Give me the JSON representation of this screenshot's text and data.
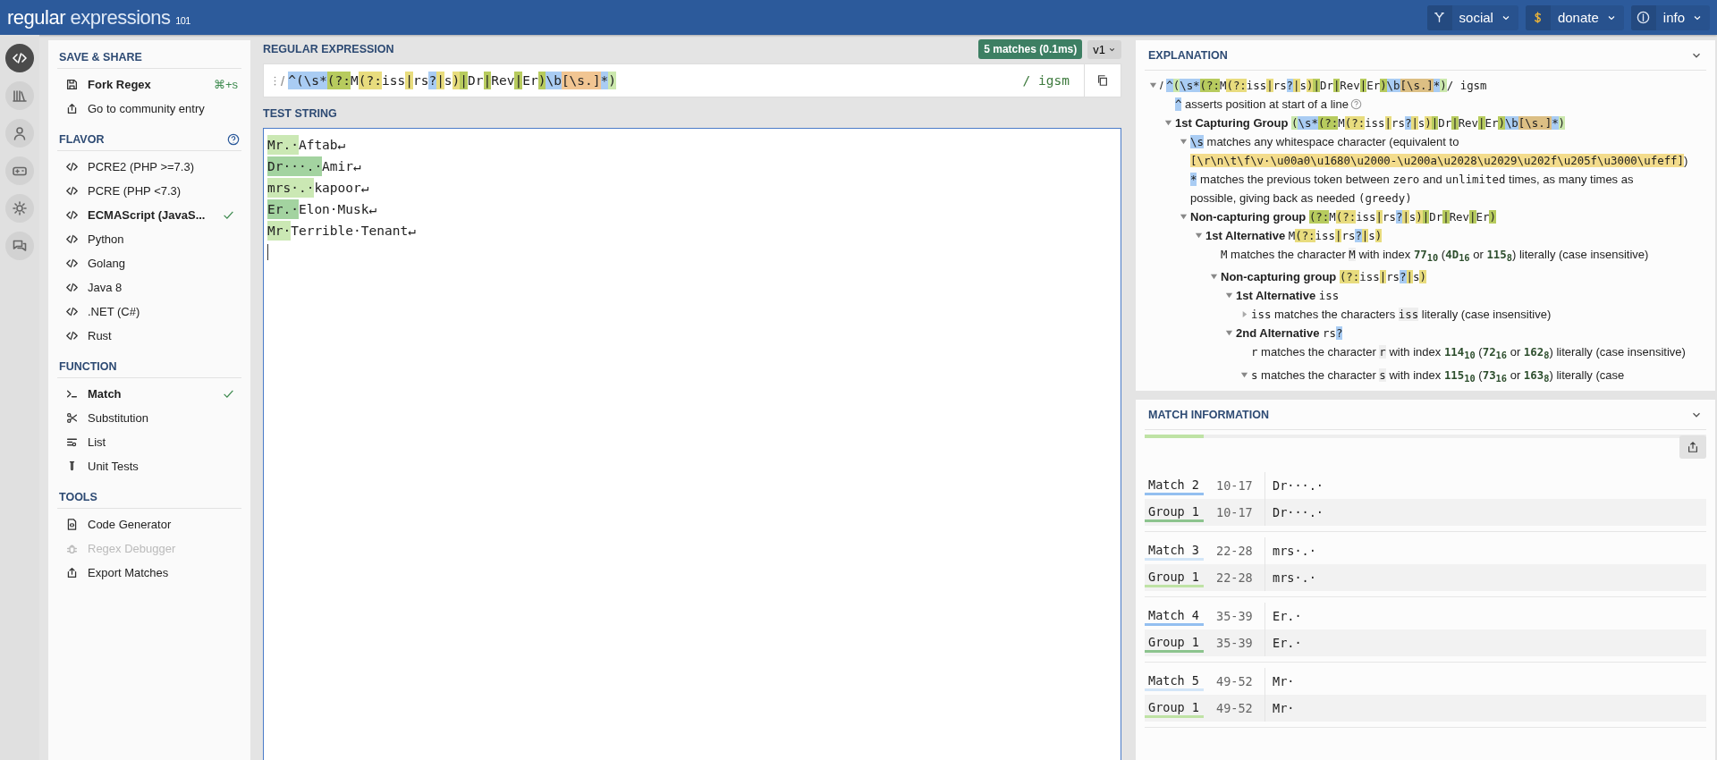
{
  "topbar": {
    "logo": {
      "word1": "regular",
      "word2": "expressions",
      "version": "101"
    },
    "menus": [
      {
        "label": "social"
      },
      {
        "label": "donate"
      },
      {
        "label": "info"
      }
    ]
  },
  "rail": [
    {
      "selected": true
    },
    {
      "selected": false
    },
    {
      "selected": false
    },
    {
      "selected": false
    },
    {
      "selected": false
    },
    {
      "selected": false
    }
  ],
  "sidebar": {
    "sections": [
      {
        "title": "SAVE & SHARE",
        "items": [
          {
            "label": "Fork Regex",
            "bold": true,
            "shortcut": "⌘+s"
          },
          {
            "label": "Go to community entry",
            "bold": false
          }
        ]
      },
      {
        "title": "FLAVOR",
        "help": true,
        "items": [
          {
            "label": "PCRE2 (PHP >=7.3)",
            "selected": false
          },
          {
            "label": "PCRE (PHP <7.3)",
            "selected": false
          },
          {
            "label": "ECMAScript (JavaS...",
            "selected": true
          },
          {
            "label": "Python",
            "selected": false
          },
          {
            "label": "Golang",
            "selected": false
          },
          {
            "label": "Java 8",
            "selected": false
          },
          {
            "label": ".NET (C#)",
            "selected": false
          },
          {
            "label": "Rust",
            "selected": false
          }
        ]
      },
      {
        "title": "FUNCTION",
        "items": [
          {
            "label": "Match",
            "selected": true
          },
          {
            "label": "Substitution",
            "selected": false
          },
          {
            "label": "List",
            "selected": false
          },
          {
            "label": "Unit Tests",
            "selected": false
          }
        ]
      },
      {
        "title": "TOOLS",
        "items": [
          {
            "label": "Code Generator",
            "disabled": false
          },
          {
            "label": "Regex Debugger",
            "disabled": true
          },
          {
            "label": "Export Matches",
            "disabled": false
          }
        ]
      }
    ]
  },
  "regex": {
    "title": "REGULAR EXPRESSION",
    "badge": "5 matches (0.1ms)",
    "version": "v1",
    "delimiter": "/",
    "flags": "/ igsm",
    "tokens": [
      {
        "t": "^",
        "color": "#a9ccf3"
      },
      {
        "t": "(",
        "color": "#a9ccf3"
      },
      {
        "t": "\\s*",
        "color": "#a9ccf3"
      },
      {
        "t": "(?:",
        "color": "#b7cb5e"
      },
      {
        "t": "M"
      },
      {
        "t": "(?:",
        "color": "#e8dc7e"
      },
      {
        "t": "iss"
      },
      {
        "t": "|",
        "color": "#e8dc7e"
      },
      {
        "t": "rs"
      },
      {
        "t": "?",
        "color": "#a9ccf3"
      },
      {
        "t": "|",
        "color": "#e8dc7e"
      },
      {
        "t": "s"
      },
      {
        "t": ")",
        "color": "#e8dc7e"
      },
      {
        "t": "|",
        "color": "#b7cb5e"
      },
      {
        "t": "Dr"
      },
      {
        "t": "|",
        "color": "#b7cb5e"
      },
      {
        "t": "Rev"
      },
      {
        "t": "|",
        "color": "#b7cb5e"
      },
      {
        "t": "Er"
      },
      {
        "t": ")",
        "color": "#b7cb5e"
      },
      {
        "t": "\\b",
        "color": "#a9ccf3"
      },
      {
        "t": "[\\s.]",
        "color": "#f1c592"
      },
      {
        "t": "*",
        "color": "#a9ccf3"
      },
      {
        "t": ")",
        "color": "#cbe8ad"
      }
    ]
  },
  "test_string": {
    "title": "TEST STRING",
    "lines": [
      {
        "match": "Mr.·",
        "rest": "Aftab↵",
        "color": "#cbe8b4"
      },
      {
        "match": "Dr···.·",
        "rest": "Amir↵",
        "color": "#a3d3a0"
      },
      {
        "match": "mrs·.·",
        "rest": "kapoor↵",
        "color": "#cbe8b4"
      },
      {
        "match": "Er.·",
        "rest": "Elon·Musk↵",
        "color": "#a3d3a0"
      },
      {
        "match": "Mr·",
        "rest": "Terrible·Tenant↵",
        "color": "#cbe8b4"
      }
    ]
  },
  "explanation": {
    "title": "EXPLANATION",
    "tree": [
      {
        "expanded": true,
        "parts": [
          {
            "kind": "text",
            "t": "/"
          },
          {
            "kind": "code",
            "t": "^",
            "color": "#a9ccf3"
          },
          {
            "kind": "code",
            "t": "(",
            "color": "#cbe8ad"
          },
          {
            "kind": "code",
            "t": "\\s*",
            "color": "#a9ccf3"
          },
          {
            "kind": "code",
            "t": "(?:",
            "color": "#b7cb5e"
          },
          {
            "kind": "code",
            "t": "M"
          },
          {
            "kind": "code",
            "t": "(?:",
            "color": "#e8dc7e"
          },
          {
            "kind": "code",
            "t": "iss"
          },
          {
            "kind": "code",
            "t": "|",
            "color": "#e8dc7e"
          },
          {
            "kind": "code",
            "t": "rs"
          },
          {
            "kind": "code",
            "t": "?",
            "color": "#a9ccf3"
          },
          {
            "kind": "code",
            "t": "|",
            "color": "#e8dc7e"
          },
          {
            "kind": "code",
            "t": "s"
          },
          {
            "kind": "code",
            "t": ")",
            "color": "#e8dc7e"
          },
          {
            "kind": "code",
            "t": "|",
            "color": "#b7cb5e"
          },
          {
            "kind": "code",
            "t": "Dr"
          },
          {
            "kind": "code",
            "t": "|",
            "color": "#b7cb5e"
          },
          {
            "kind": "code",
            "t": "Rev"
          },
          {
            "kind": "code",
            "t": "|",
            "color": "#b7cb5e"
          },
          {
            "kind": "code",
            "t": "Er"
          },
          {
            "kind": "code",
            "t": ")",
            "color": "#b7cb5e"
          },
          {
            "kind": "code",
            "t": "\\b",
            "color": "#a9ccf3"
          },
          {
            "kind": "code",
            "t": "[\\s.]",
            "color": "#dcbf84"
          },
          {
            "kind": "code",
            "t": "*",
            "color": "#a9ccf3"
          },
          {
            "kind": "code",
            "t": ")",
            "color": "#cbe8ad"
          },
          {
            "kind": "code",
            "t": "/ igsm"
          }
        ],
        "children": [
          {
            "parts": [
              {
                "kind": "code",
                "t": "^",
                "color": "#a9ccf3"
              },
              {
                "kind": "text",
                "t": "asserts position at start of a line"
              },
              {
                "kind": "help"
              }
            ]
          },
          {
            "expanded": true,
            "parts": [
              {
                "kind": "bold",
                "t": "1st Capturing Group"
              },
              {
                "kind": "code",
                "t": "(",
                "color": "#cbe8ad"
              },
              {
                "kind": "code",
                "t": "\\s*",
                "color": "#a9ccf3"
              },
              {
                "kind": "code",
                "t": "(?:",
                "color": "#b7cb5e"
              },
              {
                "kind": "code",
                "t": "M"
              },
              {
                "kind": "code",
                "t": "(?:",
                "color": "#e8dc7e"
              },
              {
                "kind": "code",
                "t": "iss"
              },
              {
                "kind": "code",
                "t": "|",
                "color": "#e8dc7e"
              },
              {
                "kind": "code",
                "t": "rs"
              },
              {
                "kind": "code",
                "t": "?",
                "color": "#a9ccf3"
              },
              {
                "kind": "code",
                "t": "|",
                "color": "#e8dc7e"
              },
              {
                "kind": "code",
                "t": "s"
              },
              {
                "kind": "code",
                "t": ")",
                "color": "#e8dc7e"
              },
              {
                "kind": "code",
                "t": "|",
                "color": "#b7cb5e"
              },
              {
                "kind": "code",
                "t": "Dr"
              },
              {
                "kind": "code",
                "t": "|",
                "color": "#b7cb5e"
              },
              {
                "kind": "code",
                "t": "Rev"
              },
              {
                "kind": "code",
                "t": "|",
                "color": "#b7cb5e"
              },
              {
                "kind": "code",
                "t": "Er"
              },
              {
                "kind": "code",
                "t": ")",
                "color": "#b7cb5e"
              },
              {
                "kind": "code",
                "t": "\\b",
                "color": "#a9ccf3"
              },
              {
                "kind": "code",
                "t": "[\\s.]",
                "color": "#dcbf84"
              },
              {
                "kind": "code",
                "t": "*",
                "color": "#a9ccf3"
              },
              {
                "kind": "code",
                "t": ")",
                "color": "#cbe8ad"
              }
            ],
            "children": [
              {
                "expanded": true,
                "parts": [
                  {
                    "kind": "code",
                    "t": "\\s",
                    "color": "#a9ccf3"
                  },
                  {
                    "kind": "text",
                    "t": "matches any whitespace character (equivalent to"
                  },
                  {
                    "kind": "code",
                    "t": "[\\r\\n\\t\\f\\v",
                    "color": "#f3dc8c"
                  },
                  {
                    "kind": "code",
                    "t": "·\\u00a0\\u1680\\u2000-\\u200a\\u2028\\u2029\\u202f\\u205f\\u3000\\ufeff]",
                    "color": "#f3dc8c"
                  },
                  {
                    "kind": "text",
                    "t": ")"
                  }
                ]
              },
              {
                "parts": [
                  {
                    "kind": "code",
                    "t": "*",
                    "color": "#a9ccf3"
                  },
                  {
                    "kind": "text",
                    "t": "matches the previous token between"
                  },
                  {
                    "kind": "code",
                    "t": "zero"
                  },
                  {
                    "kind": "text",
                    "t": "and"
                  },
                  {
                    "kind": "code",
                    "t": "unlimited"
                  },
                  {
                    "kind": "text",
                    "t": "times, as many times as"
                  },
                  {
                    "kind": "text",
                    "t": "possible, giving back as needed"
                  },
                  {
                    "kind": "code",
                    "t": "(greedy)"
                  }
                ]
              },
              {
                "expanded": true,
                "parts": [
                  {
                    "kind": "bold",
                    "t": "Non-capturing group"
                  },
                  {
                    "kind": "code",
                    "t": "(?:",
                    "color": "#b7cb5e"
                  },
                  {
                    "kind": "code",
                    "t": "M"
                  },
                  {
                    "kind": "code",
                    "t": "(?:",
                    "color": "#e8dc7e"
                  },
                  {
                    "kind": "code",
                    "t": "iss"
                  },
                  {
                    "kind": "code",
                    "t": "|",
                    "color": "#e8dc7e"
                  },
                  {
                    "kind": "code",
                    "t": "rs"
                  },
                  {
                    "kind": "code",
                    "t": "?",
                    "color": "#a9ccf3"
                  },
                  {
                    "kind": "code",
                    "t": "|",
                    "color": "#e8dc7e"
                  },
                  {
                    "kind": "code",
                    "t": "s"
                  },
                  {
                    "kind": "code",
                    "t": ")",
                    "color": "#e8dc7e"
                  },
                  {
                    "kind": "code",
                    "t": "|",
                    "color": "#b7cb5e"
                  },
                  {
                    "kind": "code",
                    "t": "Dr"
                  },
                  {
                    "kind": "code",
                    "t": "|",
                    "color": "#b7cb5e"
                  },
                  {
                    "kind": "code",
                    "t": "Rev"
                  },
                  {
                    "kind": "code",
                    "t": "|",
                    "color": "#b7cb5e"
                  },
                  {
                    "kind": "code",
                    "t": "Er"
                  },
                  {
                    "kind": "code",
                    "t": ")",
                    "color": "#b7cb5e"
                  }
                ],
                "children": [
                  {
                    "expanded": true,
                    "parts": [
                      {
                        "kind": "bold",
                        "t": "1st Alternative"
                      },
                      {
                        "kind": "code",
                        "t": "M"
                      },
                      {
                        "kind": "code",
                        "t": "(?:",
                        "color": "#e8dc7e"
                      },
                      {
                        "kind": "code",
                        "t": "iss"
                      },
                      {
                        "kind": "code",
                        "t": "|",
                        "color": "#e8dc7e"
                      },
                      {
                        "kind": "code",
                        "t": "rs"
                      },
                      {
                        "kind": "code",
                        "t": "?",
                        "color": "#a9ccf3"
                      },
                      {
                        "kind": "code",
                        "t": "|",
                        "color": "#e8dc7e"
                      },
                      {
                        "kind": "code",
                        "t": "s"
                      },
                      {
                        "kind": "code",
                        "t": ")",
                        "color": "#e8dc7e"
                      }
                    ],
                    "children": [
                      {
                        "parts": [
                          {
                            "kind": "code",
                            "t": "M"
                          },
                          {
                            "kind": "text",
                            "t": "matches the character"
                          },
                          {
                            "kind": "chip",
                            "t": "M"
                          },
                          {
                            "kind": "text",
                            "t": "with index"
                          },
                          {
                            "kind": "num",
                            "t": "77$_{10}$"
                          },
                          {
                            "kind": "text",
                            "t": "("
                          },
                          {
                            "kind": "num",
                            "t": "4D$_{16}$"
                          },
                          {
                            "kind": "text",
                            "t": "or"
                          },
                          {
                            "kind": "num",
                            "t": "115$_{8}$"
                          },
                          {
                            "kind": "text",
                            "t": ") literally (case insensitive)"
                          }
                        ]
                      },
                      {
                        "expanded": true,
                        "parts": [
                          {
                            "kind": "bold",
                            "t": "Non-capturing group"
                          },
                          {
                            "kind": "code",
                            "t": "(?:",
                            "color": "#e8dc7e"
                          },
                          {
                            "kind": "code",
                            "t": "iss"
                          },
                          {
                            "kind": "code",
                            "t": "|",
                            "color": "#e8dc7e"
                          },
                          {
                            "kind": "code",
                            "t": "rs"
                          },
                          {
                            "kind": "code",
                            "t": "?",
                            "color": "#a9ccf3"
                          },
                          {
                            "kind": "code",
                            "t": "|",
                            "color": "#e8dc7e"
                          },
                          {
                            "kind": "code",
                            "t": "s"
                          },
                          {
                            "kind": "code",
                            "t": ")",
                            "color": "#e8dc7e"
                          }
                        ],
                        "children": [
                          {
                            "expanded": true,
                            "parts": [
                              {
                                "kind": "bold",
                                "t": "1st Alternative"
                              },
                              {
                                "kind": "code",
                                "t": "iss"
                              }
                            ],
                            "children": [
                              {
                                "expanded": false,
                                "parts": [
                                  {
                                    "kind": "code",
                                    "t": "iss"
                                  },
                                  {
                                    "kind": "text",
                                    "t": "matches the characters"
                                  },
                                  {
                                    "kind": "chip",
                                    "t": "iss"
                                  },
                                  {
                                    "kind": "text",
                                    "t": "literally (case insensitive)"
                                  }
                                ]
                              }
                            ]
                          },
                          {
                            "expanded": true,
                            "parts": [
                              {
                                "kind": "bold",
                                "t": "2nd Alternative"
                              },
                              {
                                "kind": "code",
                                "t": "rs"
                              },
                              {
                                "kind": "code",
                                "t": "?",
                                "color": "#a9ccf3"
                              }
                            ],
                            "children": [
                              {
                                "parts": [
                                  {
                                    "kind": "code",
                                    "t": "r"
                                  },
                                  {
                                    "kind": "text",
                                    "t": "matches the character"
                                  },
                                  {
                                    "kind": "chip",
                                    "t": "r"
                                  },
                                  {
                                    "kind": "text",
                                    "t": "with index"
                                  },
                                  {
                                    "kind": "num",
                                    "t": "114$_{10}$"
                                  },
                                  {
                                    "kind": "text",
                                    "t": "("
                                  },
                                  {
                                    "kind": "num",
                                    "t": "72$_{16}$"
                                  },
                                  {
                                    "kind": "text",
                                    "t": "or"
                                  },
                                  {
                                    "kind": "num",
                                    "t": "162$_{8}$"
                                  },
                                  {
                                    "kind": "text",
                                    "t": ") literally (case insensitive)"
                                  }
                                ]
                              },
                              {
                                "expanded": true,
                                "parts": [
                                  {
                                    "kind": "code",
                                    "t": "s"
                                  },
                                  {
                                    "kind": "text",
                                    "t": "matches the character"
                                  },
                                  {
                                    "kind": "chip",
                                    "t": "s"
                                  },
                                  {
                                    "kind": "text",
                                    "t": "with index"
                                  },
                                  {
                                    "kind": "num",
                                    "t": "115$_{10}$"
                                  },
                                  {
                                    "kind": "text",
                                    "t": "("
                                  },
                                  {
                                    "kind": "num",
                                    "t": "73$_{16}$"
                                  },
                                  {
                                    "kind": "text",
                                    "t": "or"
                                  },
                                  {
                                    "kind": "num",
                                    "t": "163$_{8}$"
                                  },
                                  {
                                    "kind": "text",
                                    "t": ") literally (case"
                                  }
                                ]
                              }
                            ]
                          }
                        ]
                      }
                    ]
                  }
                ]
              }
            ]
          }
        ]
      }
    ]
  },
  "match_info": {
    "title": "MATCH INFORMATION",
    "matches": [
      {
        "rows": [
          {
            "label": "Match 2",
            "range": "10-17",
            "value": "Dr···.·",
            "color": "#93bff0"
          },
          {
            "label": "Group 1",
            "range": "10-17",
            "value": "Dr···.·",
            "color": "#8cc48e"
          }
        ]
      },
      {
        "rows": [
          {
            "label": "Match 3",
            "range": "22-28",
            "value": "mrs·.·",
            "color": "#d3e6f8"
          },
          {
            "label": "Group 1",
            "range": "22-28",
            "value": "mrs·.·",
            "color": "#bfe3a5"
          }
        ]
      },
      {
        "rows": [
          {
            "label": "Match 4",
            "range": "35-39",
            "value": "Er.·",
            "color": "#93bff0"
          },
          {
            "label": "Group 1",
            "range": "35-39",
            "value": "Er.·",
            "color": "#8cc48e"
          }
        ]
      },
      {
        "rows": [
          {
            "label": "Match 5",
            "range": "49-52",
            "value": "Mr·",
            "color": "#d3e6f8"
          },
          {
            "label": "Group 1",
            "range": "49-52",
            "value": "Mr·",
            "color": "#bfe3a5"
          }
        ]
      }
    ]
  }
}
